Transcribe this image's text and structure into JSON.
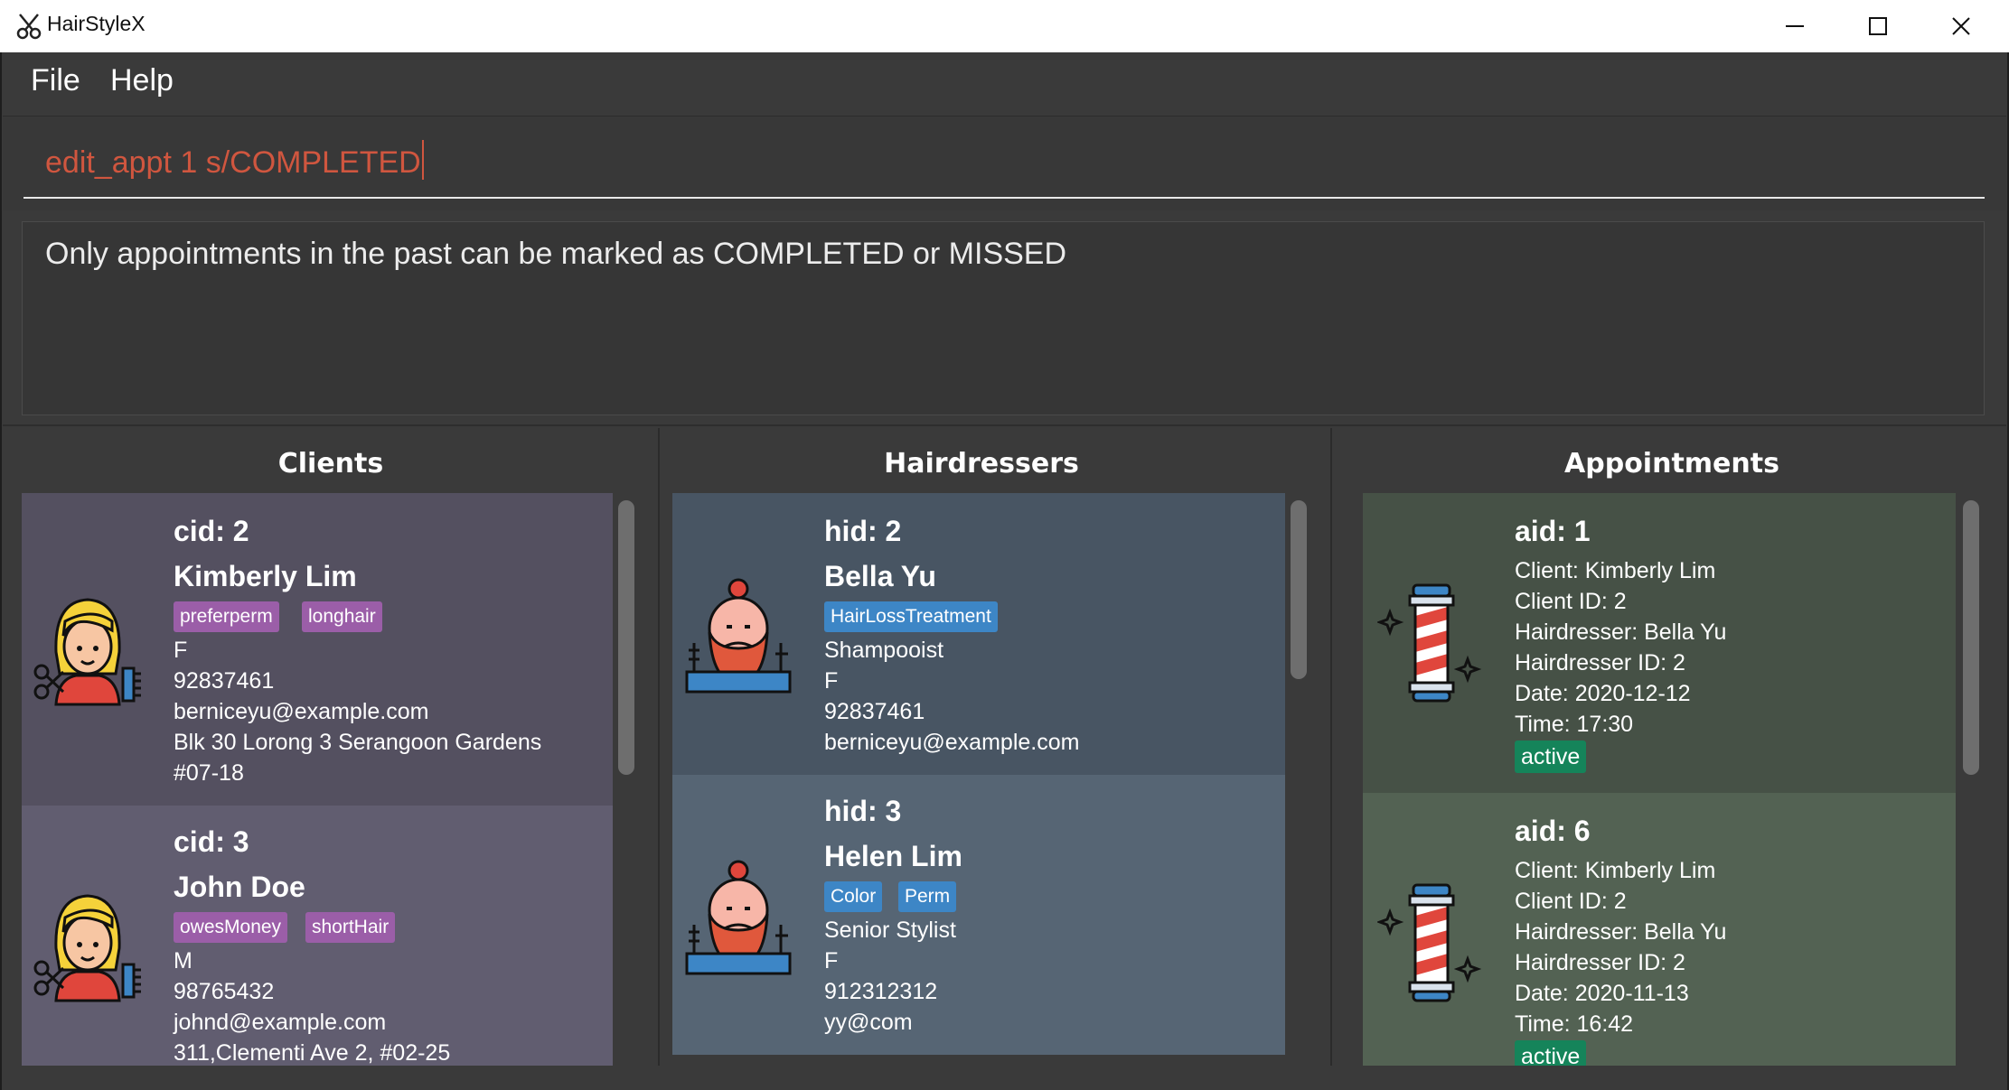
{
  "window": {
    "title": "HairStyleX",
    "colors": {
      "titlebar_bg": "#ffffff",
      "frame_bg": "#3a3a3a"
    }
  },
  "menu": {
    "items": [
      "File",
      "Help"
    ]
  },
  "command": {
    "value": "edit_appt 1 s/COMPLETED",
    "color": "#d0563f"
  },
  "result": {
    "message": "Only appointments in the past can be marked as COMPLETED or MISSED"
  },
  "columns": {
    "clients": "Clients",
    "hairdressers": "Hairdressers",
    "appointments": "Appointments"
  },
  "clients": [
    {
      "id_label": "cid: 2",
      "name": "Kimberly Lim",
      "tags": [
        "preferperm",
        "longhair"
      ],
      "gender": "F",
      "phone": "92837461",
      "email": "berniceyu@example.com",
      "address_line1": "Blk 30 Lorong 3 Serangoon Gardens",
      "address_line2": "#07-18"
    },
    {
      "id_label": "cid: 3",
      "name": "John Doe",
      "tags": [
        "owesMoney",
        "shortHair"
      ],
      "gender": "M",
      "phone": "98765432",
      "email": "johnd@example.com",
      "address_line1": "311,Clementi Ave 2, #02-25",
      "address_line2": ""
    }
  ],
  "hairdressers": [
    {
      "id_label": "hid: 2",
      "name": "Bella Yu",
      "tags": [
        "HairLossTreatment"
      ],
      "title": "Shampooist",
      "gender": "F",
      "phone": "92837461",
      "email": "berniceyu@example.com"
    },
    {
      "id_label": "hid: 3",
      "name": "Helen Lim",
      "tags": [
        "Color",
        "Perm"
      ],
      "title": "Senior Stylist",
      "gender": "F",
      "phone": "912312312",
      "email": "yy@com"
    }
  ],
  "appointments": [
    {
      "id_label": "aid: 1",
      "client": "Client:  Kimberly Lim",
      "client_id": "Client ID: 2",
      "hairdresser": "Hairdresser:  Bella Yu",
      "hairdresser_id": "Hairdresser ID: 2",
      "date": "Date: 2020-12-12",
      "time": "Time: 17:30",
      "status": "active"
    },
    {
      "id_label": "aid: 6",
      "client": "Client:  Kimberly Lim",
      "client_id": "Client ID: 2",
      "hairdresser": "Hairdresser:  Bella Yu",
      "hairdresser_id": "Hairdresser ID: 2",
      "date": "Date: 2020-11-13",
      "time": "Time: 16:42",
      "status": "active"
    }
  ],
  "icons": {
    "client_avatar": "hairdresser-woman-icon",
    "hairdresser_avatar": "bearded-barber-icon",
    "appointment_avatar": "barber-pole-icon"
  },
  "colors": {
    "client_card_1": "#545060",
    "client_card_2": "#615d70",
    "client_tag": "#9b5ea8",
    "hairdresser_card_1": "#485563",
    "hairdresser_card_2": "#566574",
    "hairdresser_tag": "#3d86c6",
    "appointment_card_1": "#465146",
    "appointment_card_2": "#536253",
    "status_active": "#15845a"
  }
}
